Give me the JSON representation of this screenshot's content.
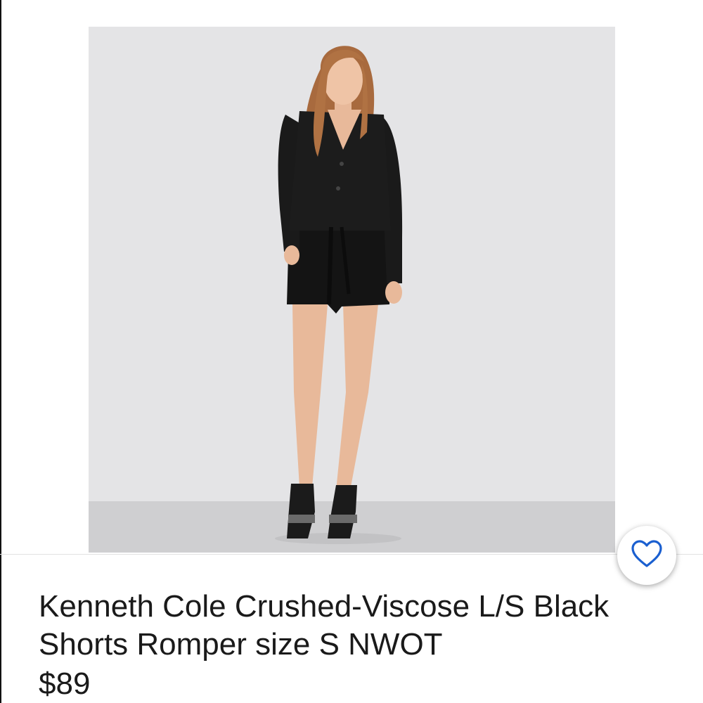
{
  "listing": {
    "title": "Kenneth Cole Crushed-Viscose L/S Black Shorts Romper size S NWOT",
    "price": "$89"
  },
  "image": {
    "subject": "model wearing black long-sleeve shorts romper"
  },
  "watch": {
    "icon": "heart-icon",
    "color": "#1a5fd0"
  },
  "colors": {
    "photo_background": "#e4e4e6",
    "floor": "#cfcfd1",
    "text": "#1a1a1a"
  }
}
